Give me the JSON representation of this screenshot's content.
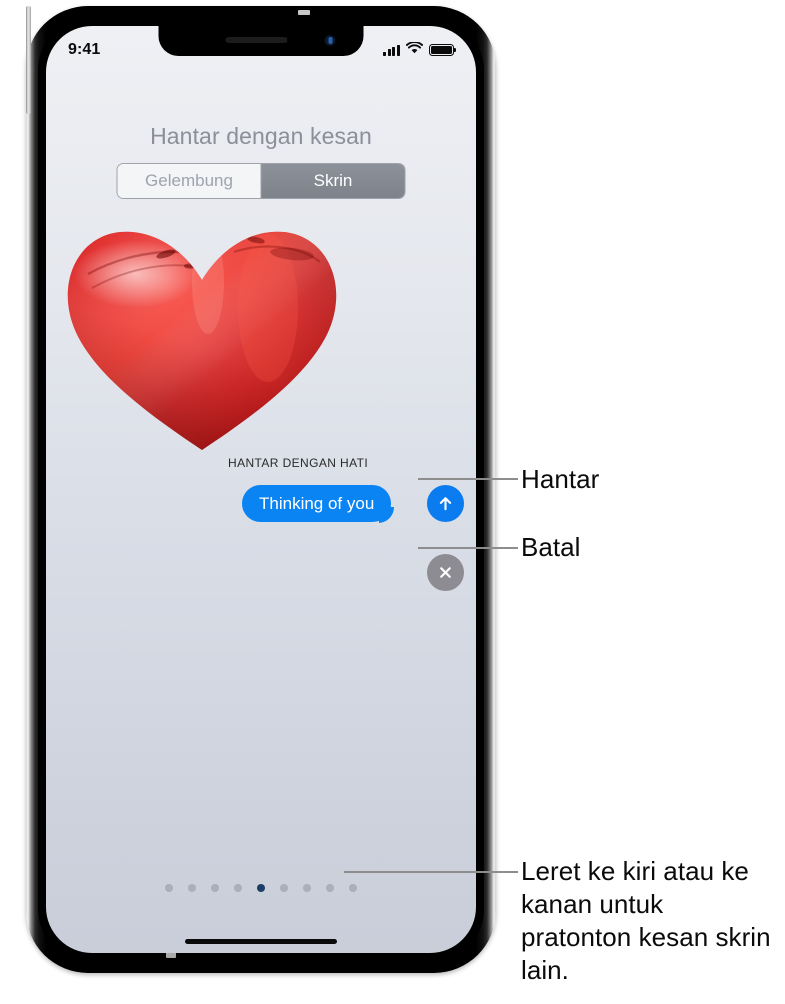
{
  "device": {
    "name": "iphone-x",
    "status_bar": {
      "time": "9:41",
      "cellular_icon": "signal-bars-icon",
      "wifi_icon": "wifi-icon",
      "battery_icon": "battery-icon"
    },
    "notch": {
      "speaker_icon": "speaker-grille-icon",
      "camera_icon": "front-camera-icon"
    },
    "home_indicator": "home-indicator"
  },
  "screen": {
    "title": "Hantar dengan kesan",
    "segmented_control": {
      "options": [
        {
          "label": "Gelembung",
          "selected": false
        },
        {
          "label": "Skrin",
          "selected": true
        }
      ]
    },
    "effect_preview": {
      "graphic": "red-heart-balloon",
      "caption": "HANTAR DENGAN HATI"
    },
    "message": {
      "bubble_text": "Thinking of you",
      "bubble_color": "#0b84f3",
      "text_color": "#ffffff"
    },
    "actions": [
      {
        "name": "send",
        "icon": "arrow-up-icon",
        "color": "#0b7cf0"
      },
      {
        "name": "cancel",
        "icon": "close-x-icon",
        "color": "#8c8c92"
      }
    ],
    "page_dots": {
      "count": 9,
      "active_index": 4,
      "active_color": "#1d3c66",
      "inactive_color": "#a8afbd"
    }
  },
  "callouts": {
    "send": "Hantar",
    "cancel": "Batal",
    "swipe": "Leret ke kiri atau ke kanan untuk pratonton kesan skrin lain."
  }
}
